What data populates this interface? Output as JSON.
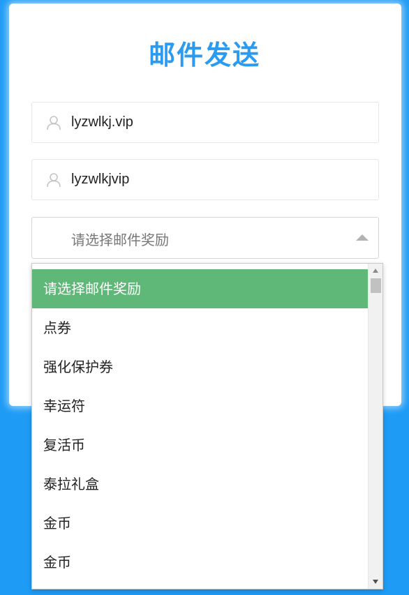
{
  "page": {
    "title": "邮件发送",
    "colors": {
      "background": "#1e9bf5",
      "title": "#2a9bf0",
      "selected_option": "#5fb878"
    }
  },
  "form": {
    "field1": {
      "icon": "user-icon",
      "value": "lyzwlkj.vip"
    },
    "field2": {
      "icon": "user-icon",
      "value": "lyzwlkjvip"
    },
    "reward_select": {
      "selected_label": "请选择邮件奖励",
      "arrow_icon": "caret-up-icon"
    }
  },
  "dropdown": {
    "options": [
      "请选择邮件奖励",
      "点券",
      "强化保护券",
      "幸运符",
      "复活币",
      "泰拉礼盒",
      "金币",
      "金币"
    ],
    "selected_index": 0
  }
}
